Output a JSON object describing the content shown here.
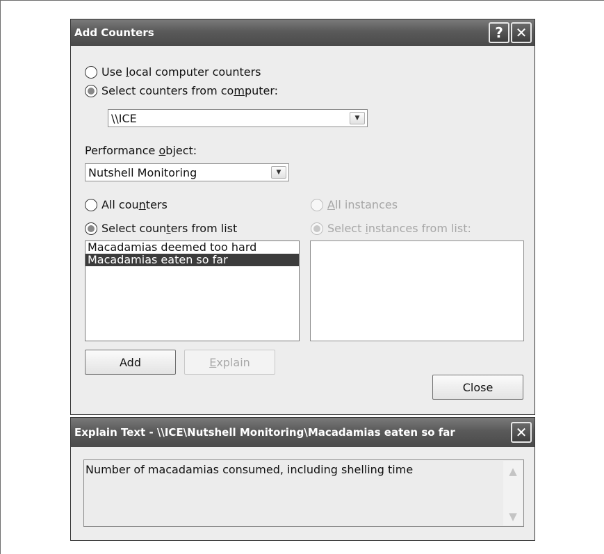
{
  "add_counters": {
    "title": "Add Counters",
    "help_label": "?",
    "close_x_label": "✕",
    "use_local_pre": "Use ",
    "use_local_key": "l",
    "use_local_post": "ocal computer counters",
    "select_from_pre": "Select counters from co",
    "select_from_key": "m",
    "select_from_post": "puter:",
    "computer_value": "\\\\ICE",
    "perf_object_pre": "Performance ",
    "perf_object_key": "o",
    "perf_object_post": "bject:",
    "perf_object_value": "Nutshell Monitoring",
    "all_counters_pre": "All cou",
    "all_counters_key": "n",
    "all_counters_post": "ters",
    "select_list_pre": "Select coun",
    "select_list_key": "t",
    "select_list_post": "ers from list",
    "all_instances_key": "A",
    "all_instances_post": "ll instances",
    "select_instances_pre": "Select ",
    "select_instances_key": "i",
    "select_instances_post": "nstances from list:",
    "counters": [
      {
        "label": "Macadamias deemed too hard",
        "selected": false
      },
      {
        "label": "Macadamias eaten so far",
        "selected": true
      }
    ],
    "add_label": "Add",
    "explain_key": "E",
    "explain_post": "xplain",
    "close_label": "Close"
  },
  "explain_window": {
    "title": "Explain Text - \\\\ICE\\Nutshell Monitoring\\Macadamias eaten so far",
    "close_x_label": "✕",
    "text": "Number of macadamias consumed, including shelling time"
  },
  "icons": {
    "dropdown": "chevron-down-icon",
    "scroll_up": "triangle-up-icon",
    "scroll_down": "triangle-down-icon"
  }
}
